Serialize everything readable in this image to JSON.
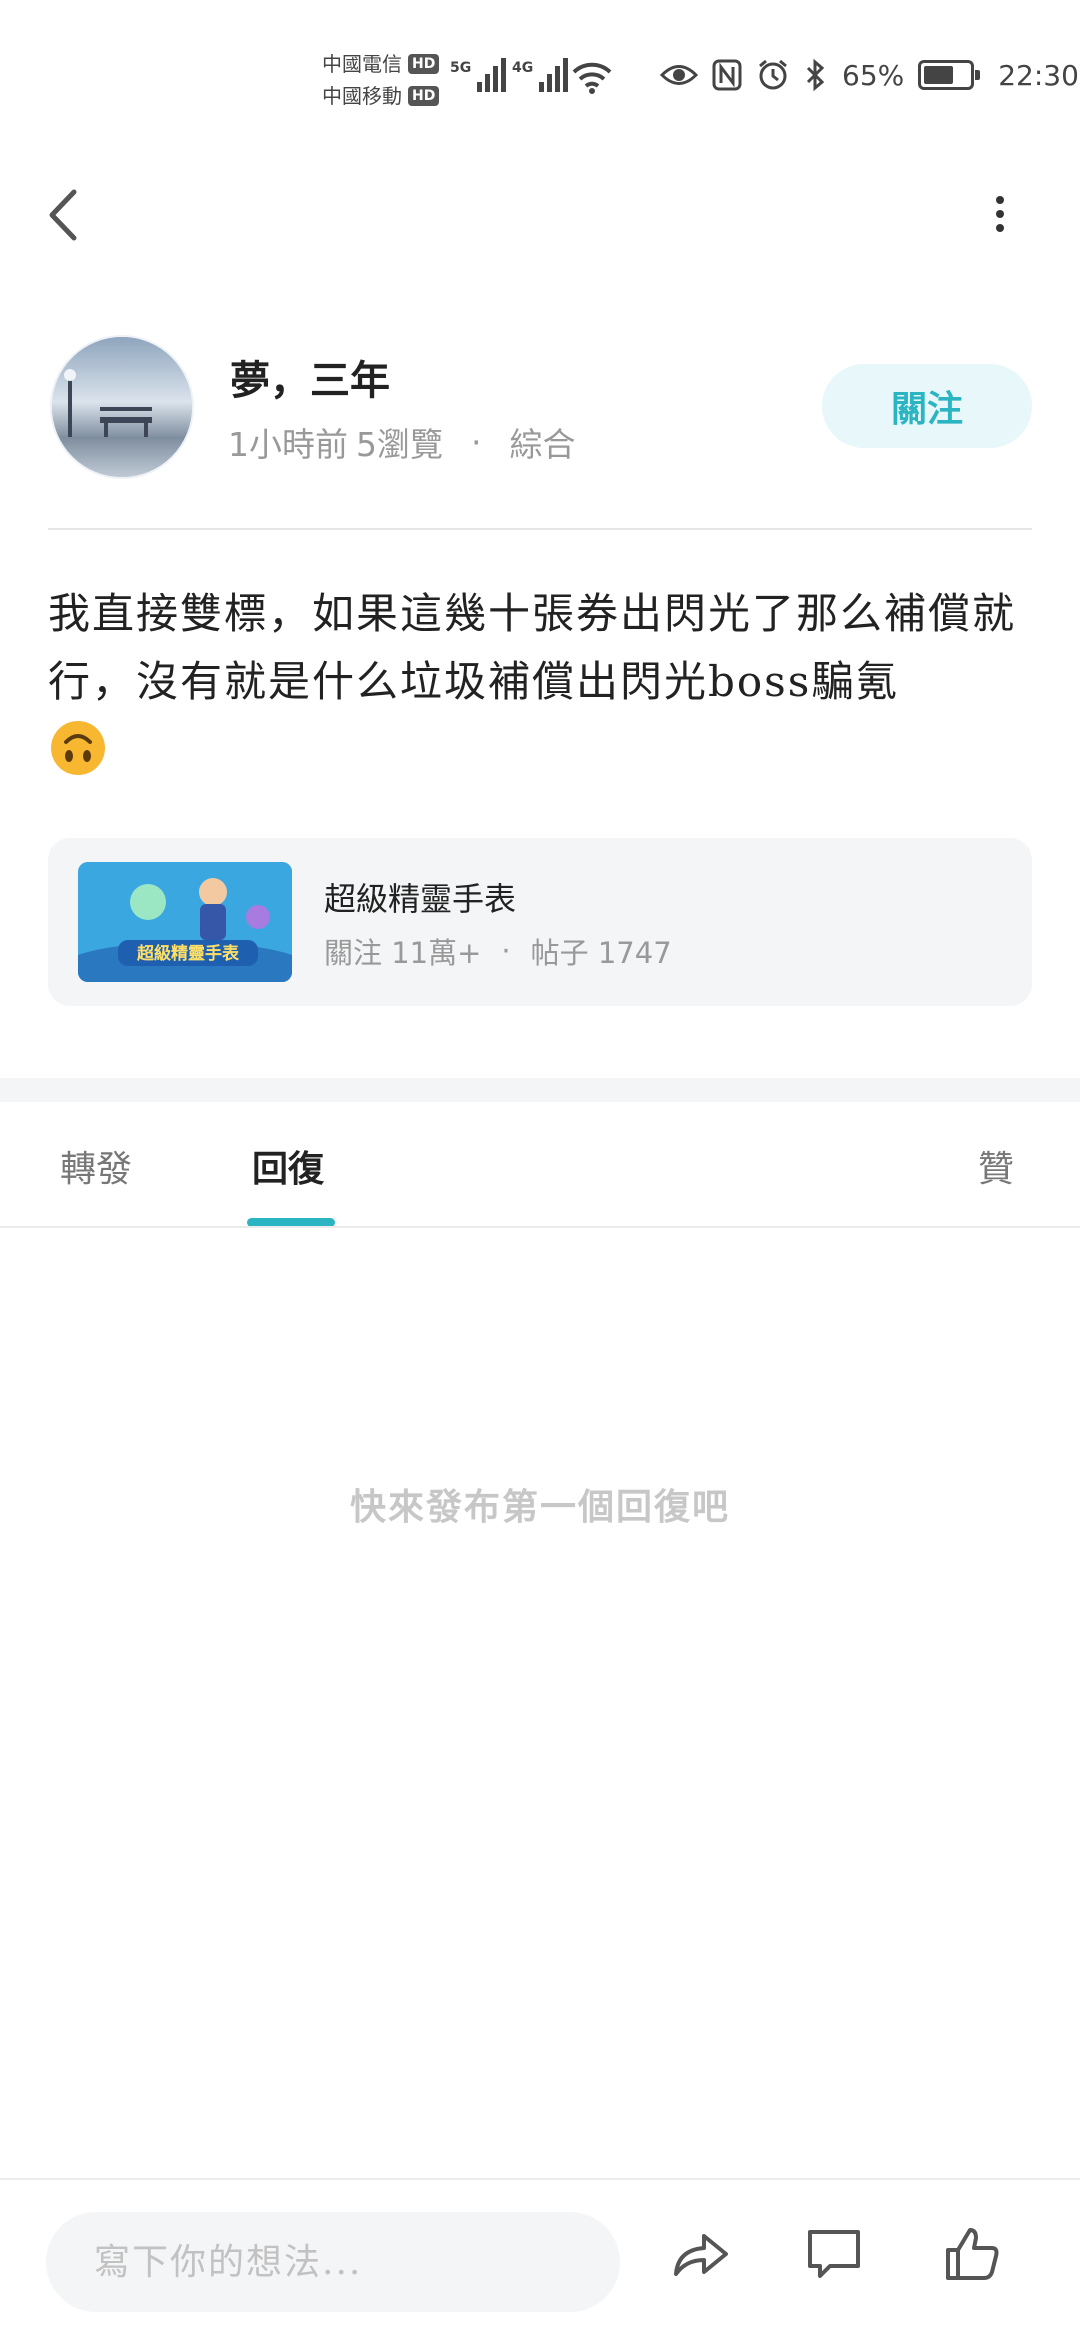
{
  "status_bar": {
    "carrier_1": "中國電信",
    "carrier_2": "中國移動",
    "hd_label": "HD",
    "network_1": "5G",
    "network_2": "4G",
    "battery_text": "65%",
    "battery_level": 0.65,
    "time": "22:30"
  },
  "post": {
    "author_name": "夢，三年",
    "time_ago": "1小時前",
    "views": "5瀏覽",
    "dot": "·",
    "category": "綜合",
    "follow_label": "關注",
    "body": "我直接雙標，如果這幾十張券出閃光了那么補償就行，沒有就是什么垃圾補償出閃光boss騙氪"
  },
  "game_card": {
    "title": "超級精靈手表",
    "followers": "關注 11萬+",
    "dot": "·",
    "posts": "帖子 1747",
    "thumb_text": "超級精靈手表"
  },
  "tabs": {
    "forward": "轉發",
    "reply": "回復",
    "like": "贊"
  },
  "empty_state": "快來發布第一個回復吧",
  "bottom_bar": {
    "input_placeholder": "寫下你的想法..."
  },
  "colors": {
    "accent": "#2bb5c2",
    "follow_bg": "#e8f7f9",
    "card_bg": "#f4f5f7"
  }
}
